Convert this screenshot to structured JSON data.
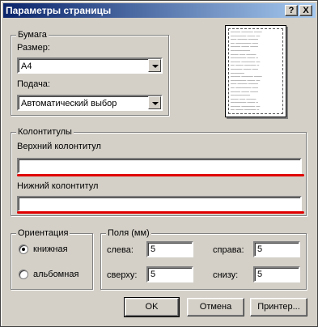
{
  "window": {
    "title": "Параметры страницы",
    "help_btn": "?",
    "close_btn": "X"
  },
  "paper": {
    "group_label": "Бумага",
    "size_label": "Размер:",
    "size_value": "А4",
    "source_label": "Подача:",
    "source_value": "Автоматический выбор"
  },
  "headers": {
    "group_label": "Колонтитулы",
    "header_label": "Верхний колонтитул",
    "header_value": "",
    "footer_label": "Нижний колонтитул",
    "footer_value": ""
  },
  "orientation": {
    "group_label": "Ориентация",
    "portrait": "книжная",
    "landscape": "альбомная",
    "selected": "portrait"
  },
  "margins": {
    "group_label": "Поля (мм)",
    "left_label": "слева:",
    "left_value": "5",
    "right_label": "справа:",
    "right_value": "5",
    "top_label": "сверху:",
    "top_value": "5",
    "bottom_label": "снизу:",
    "bottom_value": "5"
  },
  "buttons": {
    "ok": "OK",
    "cancel": "Отмена",
    "printer": "Принтер..."
  },
  "colors": {
    "title_start": "#0a246a",
    "title_end": "#a6caf0",
    "annotation": "#e00000",
    "face": "#d4d0c8"
  }
}
